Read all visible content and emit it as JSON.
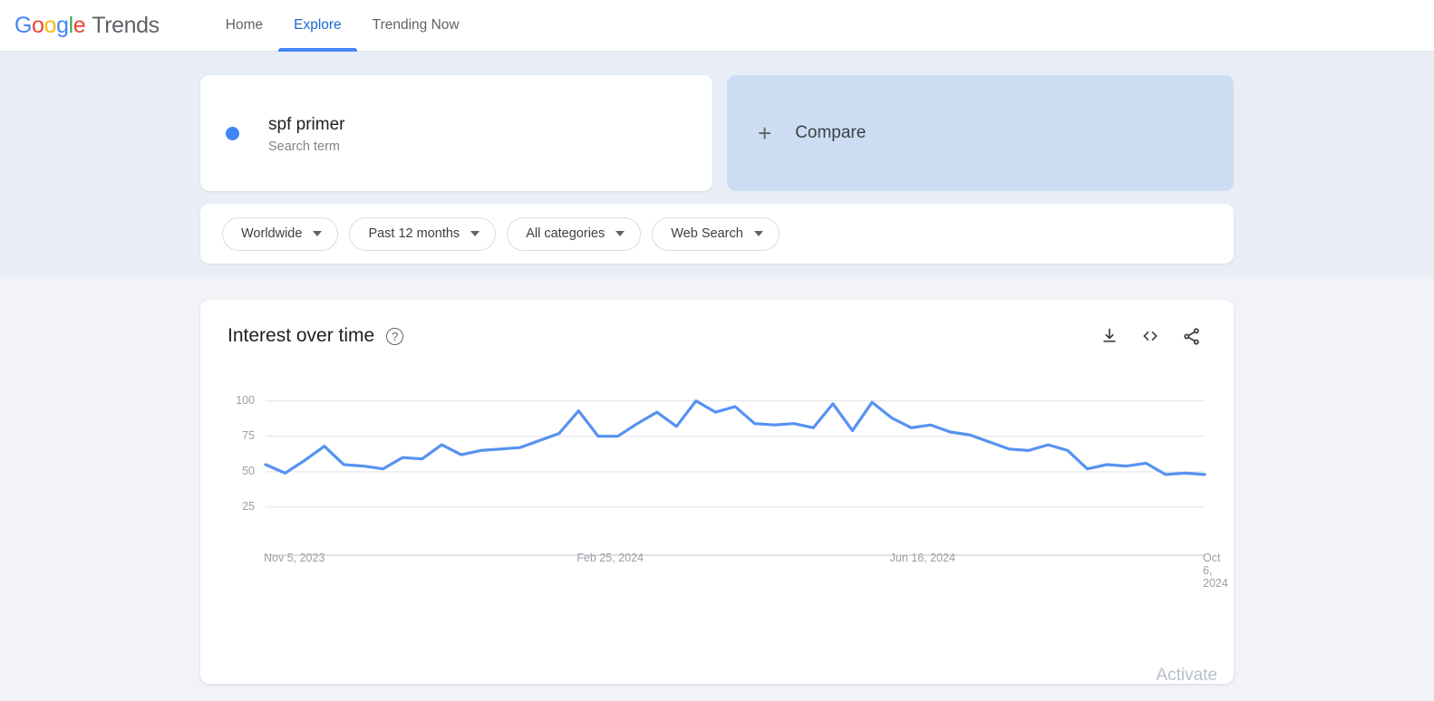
{
  "header": {
    "logo": {
      "google": "Google",
      "product": "Trends"
    },
    "nav": [
      {
        "label": "Home",
        "active": false
      },
      {
        "label": "Explore",
        "active": true
      },
      {
        "label": "Trending Now",
        "active": false
      }
    ]
  },
  "query": {
    "term": {
      "title": "spf primer",
      "subtitle": "Search term",
      "color": "#4285F4"
    },
    "compare": {
      "label": "Compare",
      "plus": "+"
    },
    "filters": [
      {
        "name": "location",
        "value": "Worldwide"
      },
      {
        "name": "time-range",
        "value": "Past 12 months"
      },
      {
        "name": "category",
        "value": "All categories"
      },
      {
        "name": "search-type",
        "value": "Web Search"
      }
    ]
  },
  "chart_card": {
    "title": "Interest over time",
    "help_tooltip": "?",
    "actions": [
      {
        "name": "download-csv",
        "icon": "download-icon"
      },
      {
        "name": "embed-code",
        "icon": "code-icon"
      },
      {
        "name": "share",
        "icon": "share-icon"
      }
    ]
  },
  "chart_data": {
    "type": "line",
    "title": "Interest over time",
    "xlabel": "",
    "ylabel": "",
    "ylim": [
      0,
      110
    ],
    "yticks": [
      100,
      75,
      50,
      25
    ],
    "grid": true,
    "legend": false,
    "line_color": "#5692f2",
    "x_tick_labels": [
      "Nov 5, 2023",
      "Feb 25, 2024",
      "Jun 16, 2024",
      "Oct 6, 2024"
    ],
    "x_tick_indices": [
      0,
      16,
      32,
      48
    ],
    "series": [
      {
        "name": "spf primer",
        "color": "#5692f2",
        "values": [
          55,
          49,
          58,
          68,
          55,
          54,
          52,
          60,
          59,
          69,
          62,
          65,
          66,
          67,
          72,
          77,
          93,
          75,
          75,
          84,
          92,
          82,
          100,
          92,
          96,
          84,
          83,
          84,
          81,
          98,
          79,
          99,
          88,
          81,
          83,
          78,
          76,
          71,
          66,
          65,
          69,
          65,
          52,
          55,
          54,
          56,
          48,
          49,
          48
        ]
      }
    ]
  },
  "watermark": {
    "text": "Activate"
  }
}
